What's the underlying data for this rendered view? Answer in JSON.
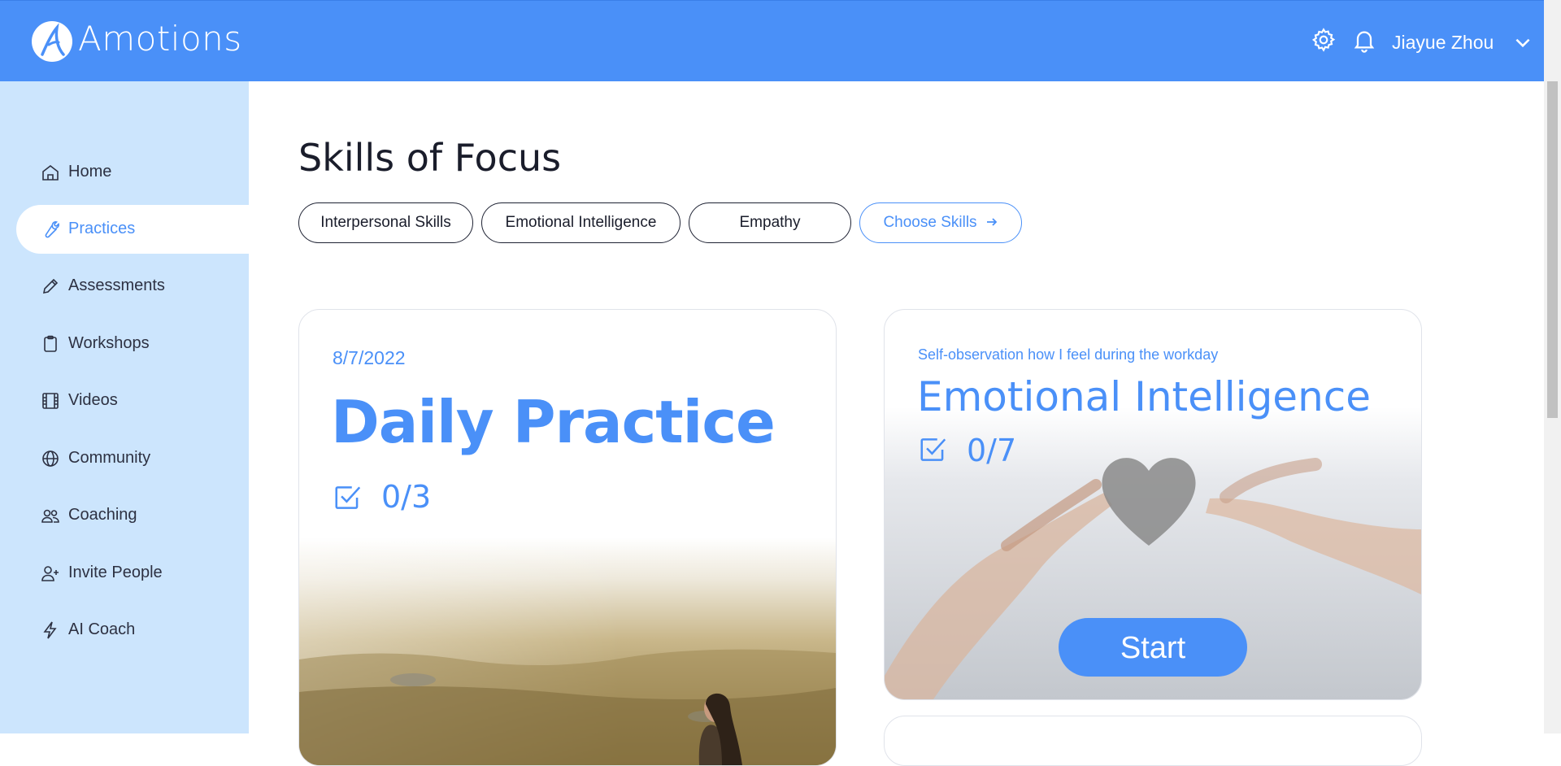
{
  "header": {
    "app_title": "Amotions",
    "user_name": "Jiayue Zhou",
    "icons": [
      "settings-gear-icon",
      "notification-bell-icon",
      "chevron-down-icon"
    ],
    "background_color": "#4a90f8"
  },
  "sidebar": {
    "background_color": "#cce5fd",
    "items": [
      {
        "label": "Home",
        "icon": "home-icon",
        "active": false
      },
      {
        "label": "Practices",
        "icon": "wrench-icon",
        "active": true
      },
      {
        "label": "Assessments",
        "icon": "pencil-icon",
        "active": false
      },
      {
        "label": "Workshops",
        "icon": "clipboard-icon",
        "active": false
      },
      {
        "label": "Videos",
        "icon": "film-icon",
        "active": false
      },
      {
        "label": "Community",
        "icon": "globe-icon",
        "active": false
      },
      {
        "label": "Coaching",
        "icon": "people-icon",
        "active": false
      },
      {
        "label": "Invite People",
        "icon": "add-user-icon",
        "active": false
      },
      {
        "label": "AI Coach",
        "icon": "lightning-icon",
        "active": false
      }
    ]
  },
  "main": {
    "title": "Skills of Focus",
    "skills": [
      "Interpersonal Skills",
      "Emotional Intelligence",
      "Empathy"
    ],
    "choose_skills_label": "Choose Skills",
    "accent_color": "#4a90f8"
  },
  "daily_card": {
    "date": "8/7/2022",
    "title": "Daily Practice",
    "progress": "0/3"
  },
  "skill_card": {
    "subtitle": "Self-observation how I feel during the workday",
    "title": "Emotional Intelligence",
    "progress": "0/7",
    "start_label": "Start"
  }
}
